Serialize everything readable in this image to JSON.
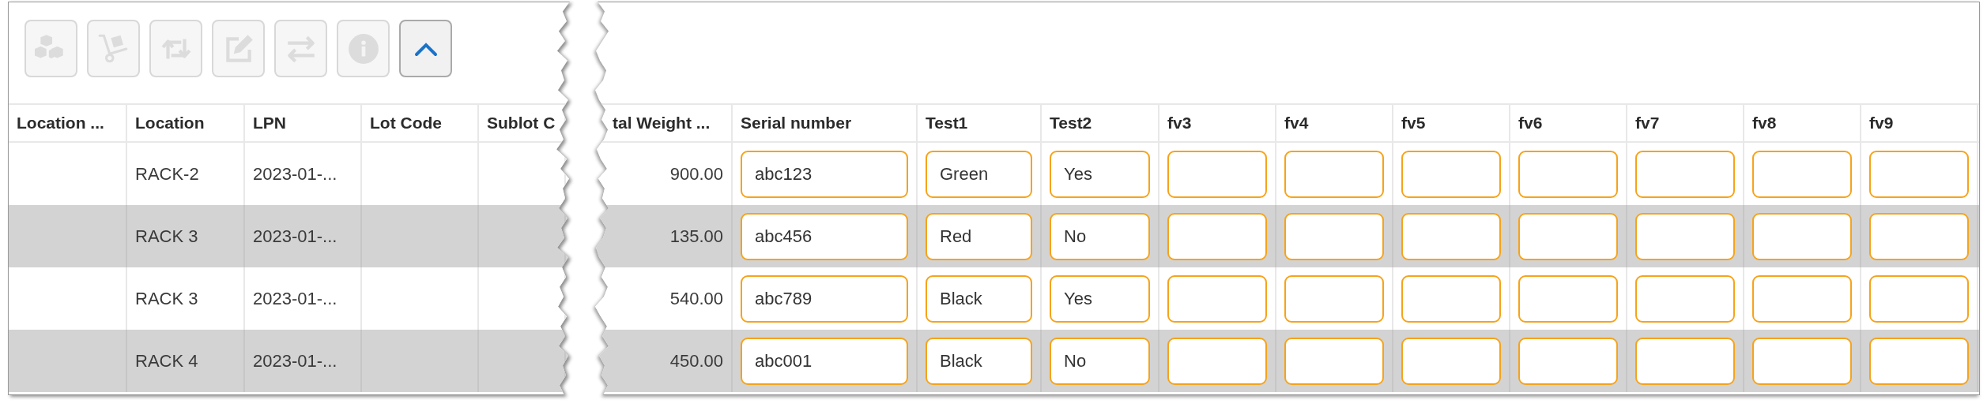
{
  "toolbar": [
    {
      "disabled": true
    },
    {
      "disabled": true
    },
    {
      "disabled": true
    },
    {
      "disabled": true
    },
    {
      "disabled": true
    },
    {
      "disabled": true
    },
    {
      "disabled": false
    }
  ],
  "table": {
    "columns": [
      {
        "label": "Location ...",
        "kind": "text"
      },
      {
        "label": "Location",
        "kind": "text"
      },
      {
        "label": "LPN",
        "kind": "text"
      },
      {
        "label": "Lot Code",
        "kind": "text"
      },
      {
        "label": "Sublot C",
        "kind": "text"
      },
      {
        "label": "tal Weight ...",
        "kind": "number"
      },
      {
        "label": "Serial number",
        "kind": "input"
      },
      {
        "label": "Test1",
        "kind": "input"
      },
      {
        "label": "Test2",
        "kind": "input"
      },
      {
        "label": "fv3",
        "kind": "input"
      },
      {
        "label": "fv4",
        "kind": "input"
      },
      {
        "label": "fv5",
        "kind": "input"
      },
      {
        "label": "fv6",
        "kind": "input"
      },
      {
        "label": "fv7",
        "kind": "input"
      },
      {
        "label": "fv8",
        "kind": "input"
      },
      {
        "label": "fv9",
        "kind": "input"
      }
    ],
    "rows": [
      {
        "cells": [
          null,
          "RACK-2",
          "2023-01-...",
          null,
          null,
          "900.00",
          "abc123",
          "Green",
          "Yes",
          null,
          null,
          null,
          null,
          null,
          null,
          null
        ]
      },
      {
        "cells": [
          null,
          "RACK 3",
          "2023-01-...",
          null,
          null,
          "135.00",
          "abc456",
          "Red",
          "No",
          null,
          null,
          null,
          null,
          null,
          null,
          null
        ]
      },
      {
        "cells": [
          null,
          "RACK 3",
          "2023-01-...",
          null,
          null,
          "540.00",
          "abc789",
          "Black",
          "Yes",
          null,
          null,
          null,
          null,
          null,
          null,
          null
        ]
      },
      {
        "cells": [
          null,
          "RACK 4",
          "2023-01-...",
          null,
          null,
          "450.00",
          "abc001",
          "Black",
          "No",
          null,
          null,
          null,
          null,
          null,
          null,
          null
        ]
      }
    ]
  }
}
